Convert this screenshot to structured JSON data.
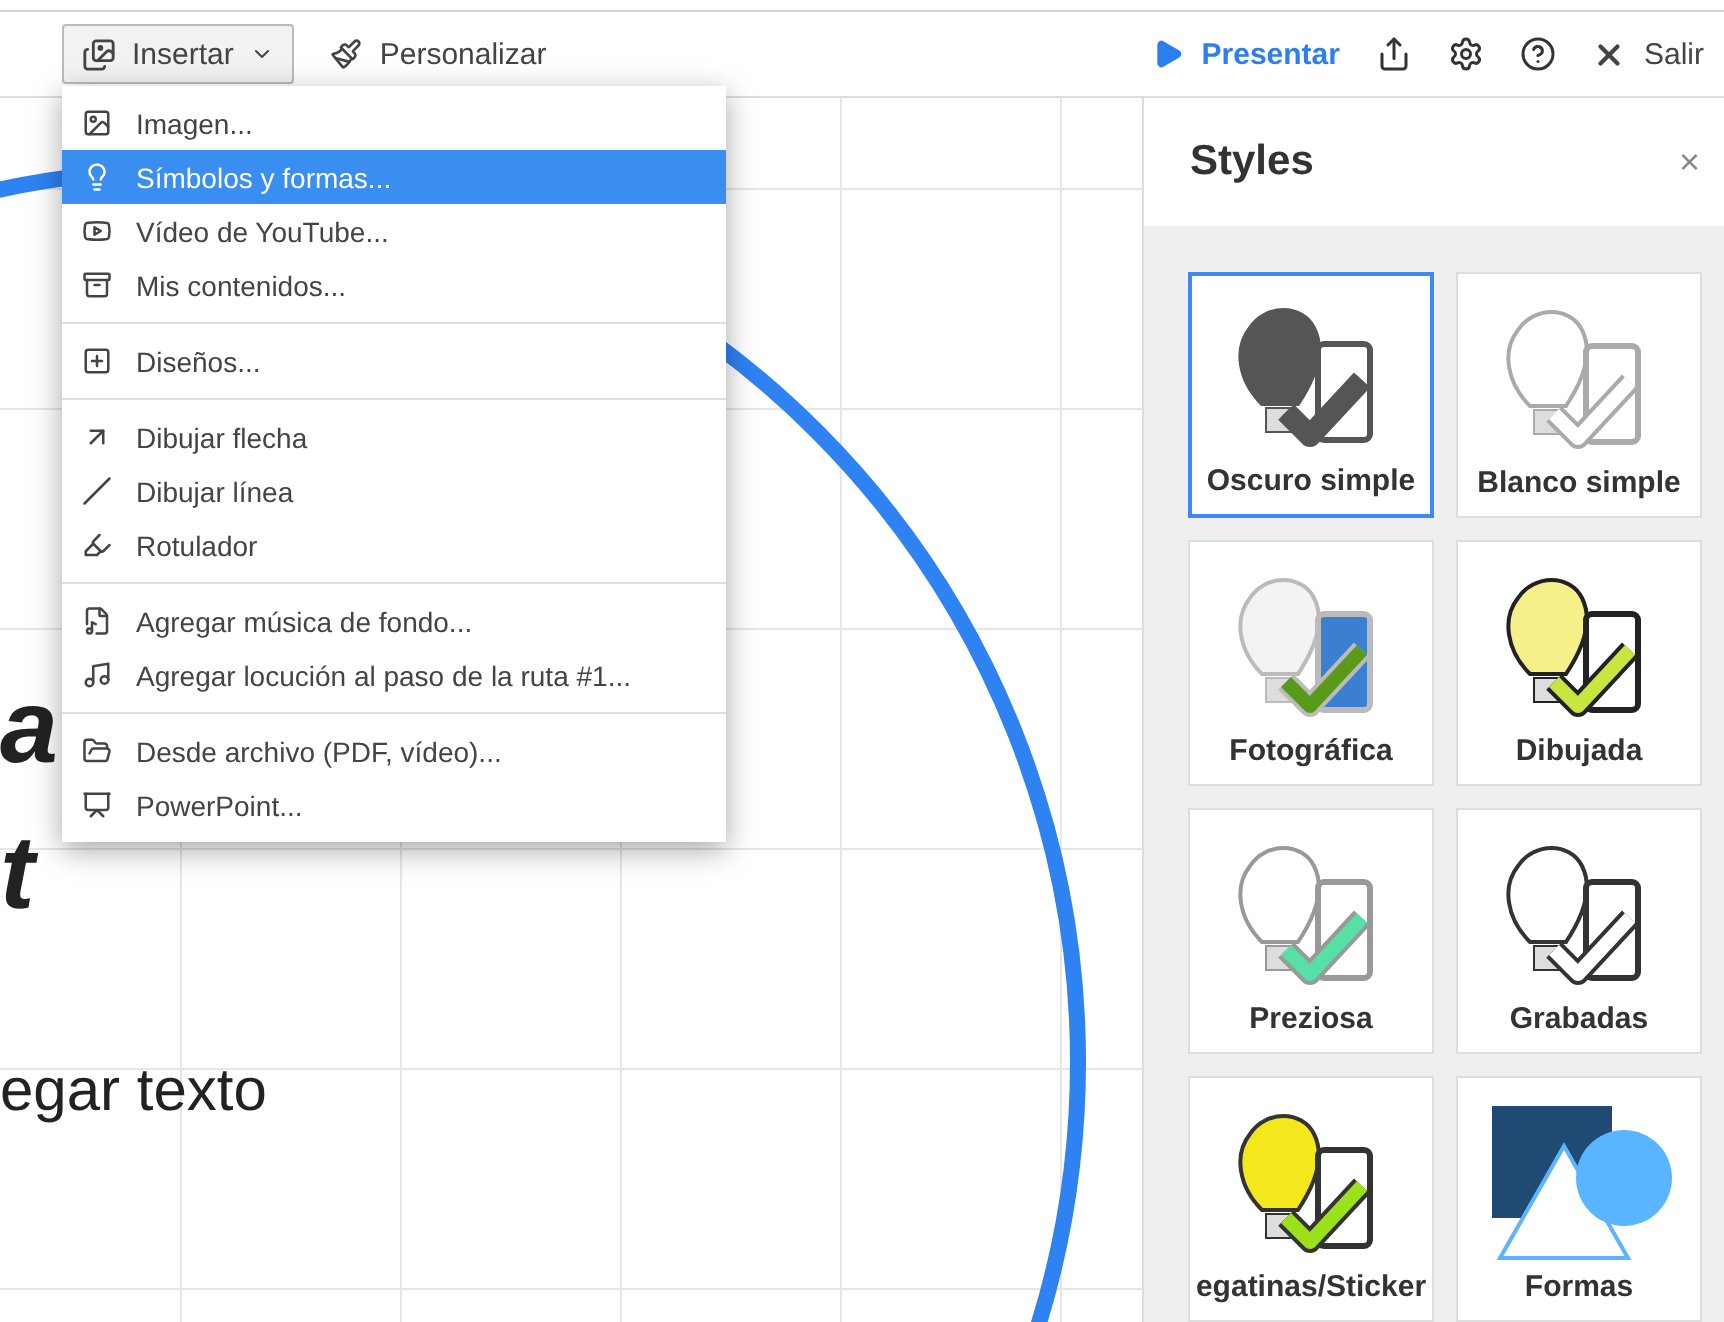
{
  "toolbar": {
    "insert_button": "Insertar",
    "customize_button": "Personalizar",
    "present_button": "Presentar",
    "exit_button": "Salir"
  },
  "canvas": {
    "texts": [
      {
        "text": "a",
        "kind": "heading"
      },
      {
        "text": "t",
        "kind": "heading"
      },
      {
        "text": "egar texto",
        "kind": "body"
      }
    ]
  },
  "insert_menu": {
    "groups": [
      [
        {
          "label": "Imagen...",
          "selected": false
        },
        {
          "label": "Símbolos y formas...",
          "selected": true
        },
        {
          "label": "Vídeo de YouTube...",
          "selected": false
        },
        {
          "label": "Mis contenidos...",
          "selected": false
        }
      ],
      [
        {
          "label": "Diseños...",
          "selected": false
        }
      ],
      [
        {
          "label": "Dibujar flecha",
          "selected": false
        },
        {
          "label": "Dibujar línea",
          "selected": false
        },
        {
          "label": "Rotulador",
          "selected": false
        }
      ],
      [
        {
          "label": "Agregar música de fondo...",
          "selected": false
        },
        {
          "label": "Agregar locución al paso de la ruta #1...",
          "selected": false
        }
      ],
      [
        {
          "label": "Desde archivo (PDF, vídeo)...",
          "selected": false
        },
        {
          "label": "PowerPoint...",
          "selected": false
        }
      ]
    ]
  },
  "styles_panel": {
    "title": "Styles",
    "close": "×",
    "styles": [
      {
        "label": "Oscuro simple",
        "kind": "dark",
        "selected": true
      },
      {
        "label": "Blanco simple",
        "kind": "outline",
        "selected": false
      },
      {
        "label": "Fotográfica",
        "kind": "photo",
        "selected": false
      },
      {
        "label": "Dibujada",
        "kind": "drawn",
        "selected": false
      },
      {
        "label": "Preziosa",
        "kind": "cute",
        "selected": false
      },
      {
        "label": "Grabadas",
        "kind": "engraved",
        "selected": false
      },
      {
        "label": "egatinas/Sticker",
        "kind": "sticker",
        "selected": false
      },
      {
        "label": "Formas",
        "kind": "shapes",
        "selected": false
      }
    ]
  }
}
